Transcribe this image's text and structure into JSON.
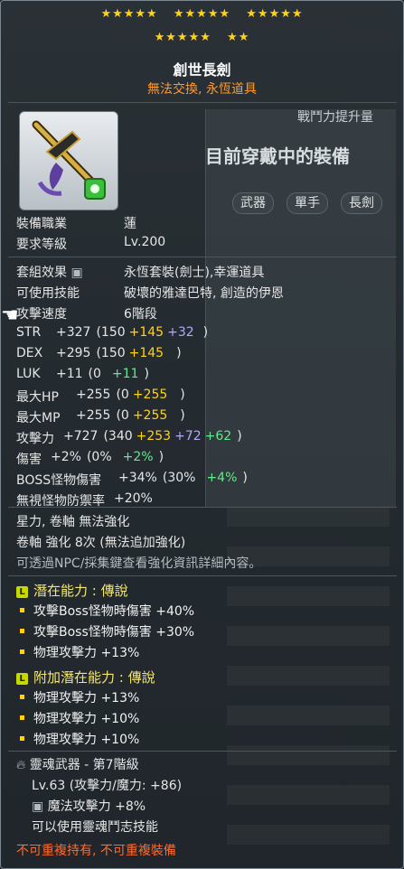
{
  "stars": {
    "row1": [
      "★★★★★",
      "★★★★★",
      "★★★★★"
    ],
    "row2": [
      "★★★★★",
      "★★"
    ]
  },
  "item": {
    "name": "創世長劍",
    "subtitle": "無法交換, 永恆道具"
  },
  "header": {
    "power_label": "戰鬥力提升量",
    "wearing": "目前穿戴中的裝備",
    "tags": [
      "武器",
      "單手",
      "長劍"
    ]
  },
  "requirements": [
    {
      "label": "裝備職業",
      "value": "蓮"
    },
    {
      "label": "要求等級",
      "value": "Lv.200"
    }
  ],
  "info": [
    {
      "label": "套組效果",
      "value": "永恆套裝(劍士),幸運道具"
    },
    {
      "label": "可使用技能",
      "value": "破壞的雅達巴特, 創造的伊恩"
    },
    {
      "label": "攻擊速度",
      "value": "6階段"
    }
  ],
  "stats": [
    {
      "label": "STR",
      "total": "+327",
      "base": "(150",
      "add1": "+145",
      "add2": "+32",
      "add3": "",
      "close": ")"
    },
    {
      "label": "DEX",
      "total": "+295",
      "base": "(150",
      "add1": "+145",
      "add2": "",
      "add3": "",
      "close": ")"
    },
    {
      "label": "LUK",
      "total": "+11",
      "base": "(0",
      "add1": "",
      "add2": "",
      "add3": "+11",
      "close": ")"
    },
    {
      "label": "最大HP",
      "total": "+255",
      "base": "(0",
      "add1": "+255",
      "add2": "",
      "add3": "",
      "close": ")"
    },
    {
      "label": "最大MP",
      "total": "+255",
      "base": "(0",
      "add1": "+255",
      "add2": "",
      "add3": "",
      "close": ")"
    },
    {
      "label": "攻擊力",
      "total": "+727",
      "base": "(340",
      "add1": "+253",
      "add2": "+72",
      "add3": "+62",
      "close": ")"
    },
    {
      "label": "傷害",
      "total": "+2%",
      "base": "(0%",
      "add1": "",
      "add2": "",
      "add3": "+2%",
      "close": ")"
    },
    {
      "label": "BOSS怪物傷害",
      "total": "+34%",
      "base": "(30%",
      "add1": "",
      "add2": "",
      "add3": "+4%",
      "close": ")"
    },
    {
      "label": "無視怪物防禦率",
      "total": "+20%",
      "base": "",
      "add1": "",
      "add2": "",
      "add3": "",
      "close": ""
    }
  ],
  "enhance": {
    "line1": "星力, 卷軸 無法強化",
    "line2": "卷軸 強化 8次 (無法追加強化)",
    "line3": "可透過NPC/採集鍵查看強化資訊詳細內容。"
  },
  "potential": {
    "title": "潛在能力 : 傳說",
    "badge": "L",
    "lines": [
      "攻擊Boss怪物時傷害 +40%",
      "攻擊Boss怪物時傷害 +30%",
      "物理攻擊力 +13%"
    ]
  },
  "additional_potential": {
    "title": "附加潛在能力 : 傳說",
    "badge": "L",
    "lines": [
      "物理攻擊力 +13%",
      "物理攻擊力 +10%",
      "物理攻擊力 +10%"
    ]
  },
  "soul": {
    "title": "靈魂武器 - 第7階級",
    "level_line": "Lv.63 (攻擊力/魔力: +86)",
    "option": "魔法攻擊力 +8%",
    "skill": "可以使用靈魂鬥志技能"
  },
  "footer": "不可重複持有, 不可重複裝備"
}
